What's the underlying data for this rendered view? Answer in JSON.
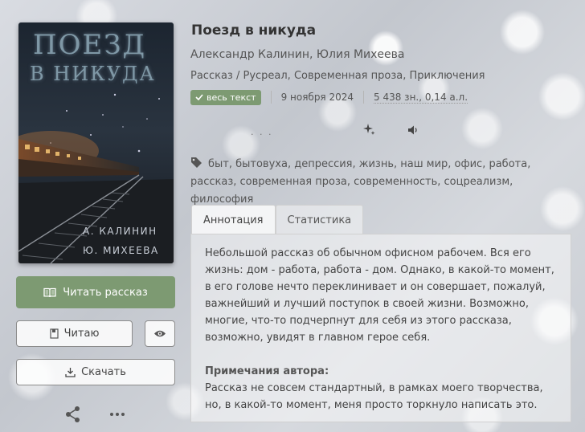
{
  "book": {
    "title": "Поезд в никуда",
    "authors": "Александр Калинин, Юлия Михеева",
    "genres": "Рассказ / Русреал, Современная проза, Приключения",
    "status_badge": "весь текст",
    "date": "9 ноября 2024",
    "size": "5 438 зн., 0,14 а.л.",
    "dots": ". . .",
    "tags": "быт, бытовуха, депрессия, жизнь, наш мир, офис, работа, рассказ, современная проза, современность, соцреализм, философия"
  },
  "cover": {
    "title_line1": "ПОЕЗД",
    "title_line2": "В НИКУДА",
    "author_line1": "А. КАЛИНИН",
    "author_line2": "Ю. МИХЕЕВА"
  },
  "actions": {
    "read_label": "Читать рассказ",
    "reading_label": "Читаю",
    "download_label": "Скачать"
  },
  "tabs": [
    {
      "label": "Аннотация"
    },
    {
      "label": "Статистика"
    }
  ],
  "annotation": {
    "text": "Небольшой рассказ об обычном офисном рабочем. Вся его жизнь: дом - работа, работа - дом. Однако, в какой-то момент, в его голове нечто переклинивает и он совершает, пожалуй, важнейший и лучший поступок в своей жизни. Возможно, многие, что-то подчерпнут для себя из этого рассказа, возможно, увидят в главном герое себя.",
    "notes_title": "Примечания автора:",
    "notes_text": "Рассказ не совсем стандартный, в рамках моего творчества, но, в какой-то момент, меня просто торкнуло написать это."
  },
  "colors": {
    "accent": "#7d9a72",
    "cover_title": "#6f8a9a",
    "cover_author": "#c9cfd8"
  }
}
